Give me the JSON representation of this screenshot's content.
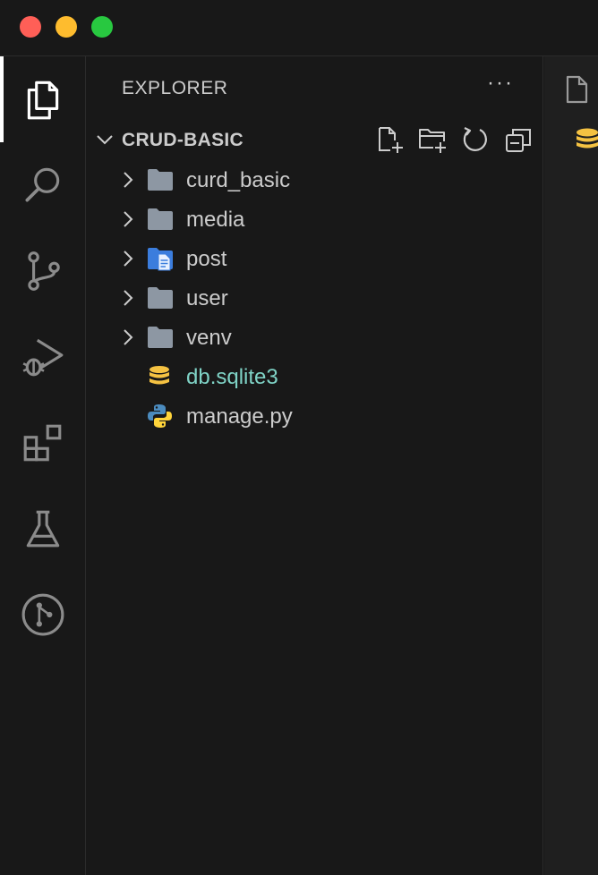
{
  "window": {
    "controls": [
      "close",
      "minimize",
      "maximize"
    ]
  },
  "activity_bar": {
    "items": [
      {
        "icon": "files-icon",
        "active": true
      },
      {
        "icon": "search-icon",
        "active": false
      },
      {
        "icon": "source-control-icon",
        "active": false
      },
      {
        "icon": "run-debug-icon",
        "active": false
      },
      {
        "icon": "extensions-icon",
        "active": false
      },
      {
        "icon": "testing-icon",
        "active": false
      },
      {
        "icon": "git-graph-icon",
        "active": false
      }
    ]
  },
  "sidebar": {
    "title": "EXPLORER",
    "more_label": "···",
    "section": {
      "title": "CRUD-BASIC",
      "actions": [
        "new-file-icon",
        "new-folder-icon",
        "refresh-icon",
        "collapse-all-icon"
      ]
    },
    "tree": [
      {
        "label": "curd_basic",
        "type": "folder"
      },
      {
        "label": "media",
        "type": "folder"
      },
      {
        "label": "post",
        "type": "folder-special"
      },
      {
        "label": "user",
        "type": "folder"
      },
      {
        "label": "venv",
        "type": "folder"
      },
      {
        "label": "db.sqlite3",
        "type": "database"
      },
      {
        "label": "manage.py",
        "type": "python"
      }
    ]
  },
  "colors": {
    "background": "#181818",
    "text": "#cccccc",
    "modified_file": "#7fd3c6",
    "folder": "#8d97a3",
    "database": "#f5c242",
    "accent_blue": "#3b7ddd"
  }
}
